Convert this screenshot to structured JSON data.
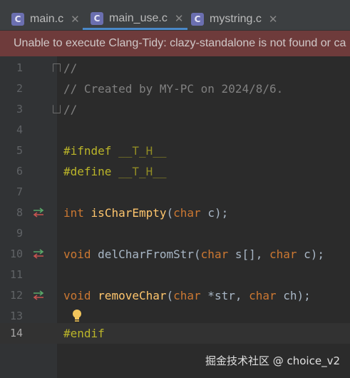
{
  "tabs": [
    {
      "label": "main.c",
      "icon": "c-file-icon",
      "active": false
    },
    {
      "label": "main_use.c",
      "icon": "c-file-icon",
      "active": true
    },
    {
      "label": "mystring.c",
      "icon": "c-file-icon",
      "active": false
    }
  ],
  "tab_icon_letter": "C",
  "close_glyph": "✕",
  "banner": {
    "message": "Unable to execute Clang-Tidy: clazy-standalone is not found or ca"
  },
  "lines": [
    {
      "n": "1",
      "text": "//"
    },
    {
      "n": "2",
      "text": "// Created by MY-PC on 2024/8/6."
    },
    {
      "n": "3",
      "text": "//"
    },
    {
      "n": "4",
      "text": ""
    },
    {
      "n": "5",
      "a": "#ifndef",
      "b": "__T_H__"
    },
    {
      "n": "6",
      "a": "#define",
      "b": "__T_H__"
    },
    {
      "n": "7",
      "text": ""
    },
    {
      "n": "8",
      "ret": "int",
      "fn": "isCharEmpty",
      "p1": "(",
      "t1": "char",
      "r1": " c);"
    },
    {
      "n": "9",
      "text": ""
    },
    {
      "n": "10",
      "ret": "void",
      "fn": "delCharFromStr",
      "p1": "(",
      "t1": "char",
      "r1": " s[], ",
      "t2": "char",
      "r2": " c);"
    },
    {
      "n": "11",
      "text": ""
    },
    {
      "n": "12",
      "ret": "void",
      "fn": "removeChar",
      "p1": "(",
      "t1": "char",
      "r1": " *str, ",
      "t2": "char",
      "r2": " ch);"
    },
    {
      "n": "13",
      "text": ""
    },
    {
      "n": "14",
      "text": "#endif"
    }
  ],
  "watermark": "掘金技术社区 @ choice_v2",
  "colors": {
    "keyword": "#cc7832",
    "function": "#ffc66d",
    "preprocessor": "#bbb529",
    "comment": "#808080",
    "banner_bg": "#6e3b3b",
    "active_tab_underline": "#4a88c7"
  }
}
